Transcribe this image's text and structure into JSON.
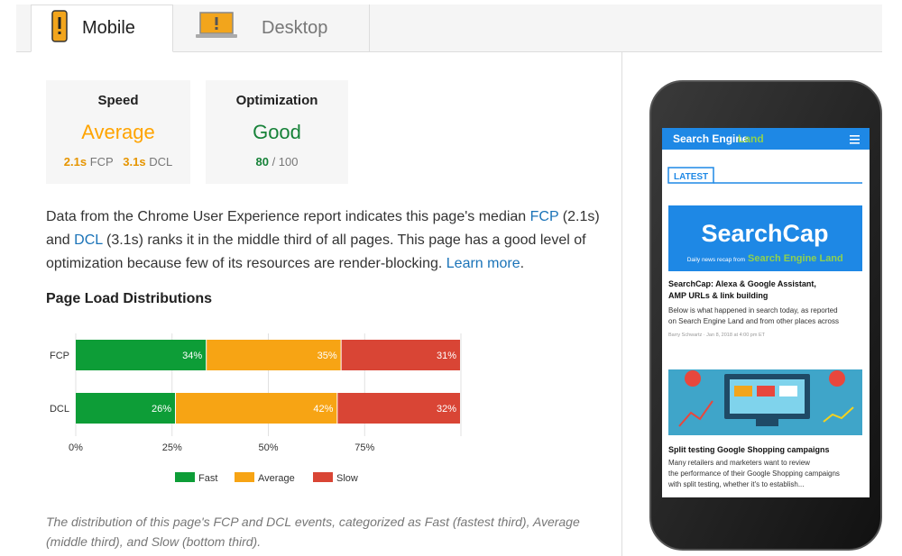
{
  "tabs": [
    {
      "label": "Mobile",
      "icon": "mobile-phone-icon",
      "active": true
    },
    {
      "label": "Desktop",
      "icon": "laptop-icon",
      "active": false
    }
  ],
  "speed": {
    "title": "Speed",
    "rating": "Average",
    "rating_color": "#ffa400",
    "fcp_value": "2.1s",
    "fcp_label": "FCP",
    "dcl_value": "3.1s",
    "dcl_label": "DCL"
  },
  "optimization": {
    "title": "Optimization",
    "rating": "Good",
    "rating_color": "#178239",
    "score": "80",
    "max": "/ 100"
  },
  "description": {
    "part1": "Data from the Chrome User Experience report indicates this page's median ",
    "fcp_link": "FCP",
    "part2": " (2.1s) and ",
    "dcl_link": "DCL",
    "part3": " (3.1s) ranks it in the middle third of all pages. This page has a good level of optimization because few of its resources are render-blocking. ",
    "learn_more": "Learn more",
    "part4": "."
  },
  "section_title": "Page Load Distributions",
  "caption": "The distribution of this page's FCP and DCL events, categorized as Fast (fastest third), Average (middle third), and Slow (bottom third).",
  "chart_data": {
    "type": "bar",
    "orientation": "horizontal-stacked",
    "categories": [
      "FCP",
      "DCL"
    ],
    "series": [
      {
        "name": "Fast",
        "values": [
          34,
          26
        ],
        "labels": [
          "34%",
          "26%"
        ],
        "color": "#0d9d37"
      },
      {
        "name": "Average",
        "values": [
          35,
          42
        ],
        "labels": [
          "35%",
          "42%"
        ],
        "color": "#f7a414"
      },
      {
        "name": "Slow",
        "values": [
          31,
          32
        ],
        "labels": [
          "31%",
          "32%"
        ],
        "color": "#d94535"
      }
    ],
    "xticks": [
      "0%",
      "25%",
      "50%",
      "75%"
    ],
    "xlim": [
      0,
      100
    ],
    "legend_position": "bottom"
  },
  "phone": {
    "brand": "Search Engine",
    "brand_accent": "Land",
    "section": "LATEST",
    "hero_title": "SearchCap",
    "hero_sub": "Daily news recap from",
    "hero_sub_brand": "Search Engine Land",
    "article1_title": "SearchCap: Alexa & Google Assistant, AMP URLs & link building",
    "article1_body": "Below is what happened in search today, as reported on Search Engine Land and from other places across",
    "article1_meta": "Barry Schwartz · Jan 8, 2018 at 4:00 pm ET",
    "article2_title": "Split testing Google Shopping campaigns",
    "article2_body": "Many retailers and marketers want to review the performance of their Google Shopping campaigns with split testing, whether it's to establish..."
  }
}
